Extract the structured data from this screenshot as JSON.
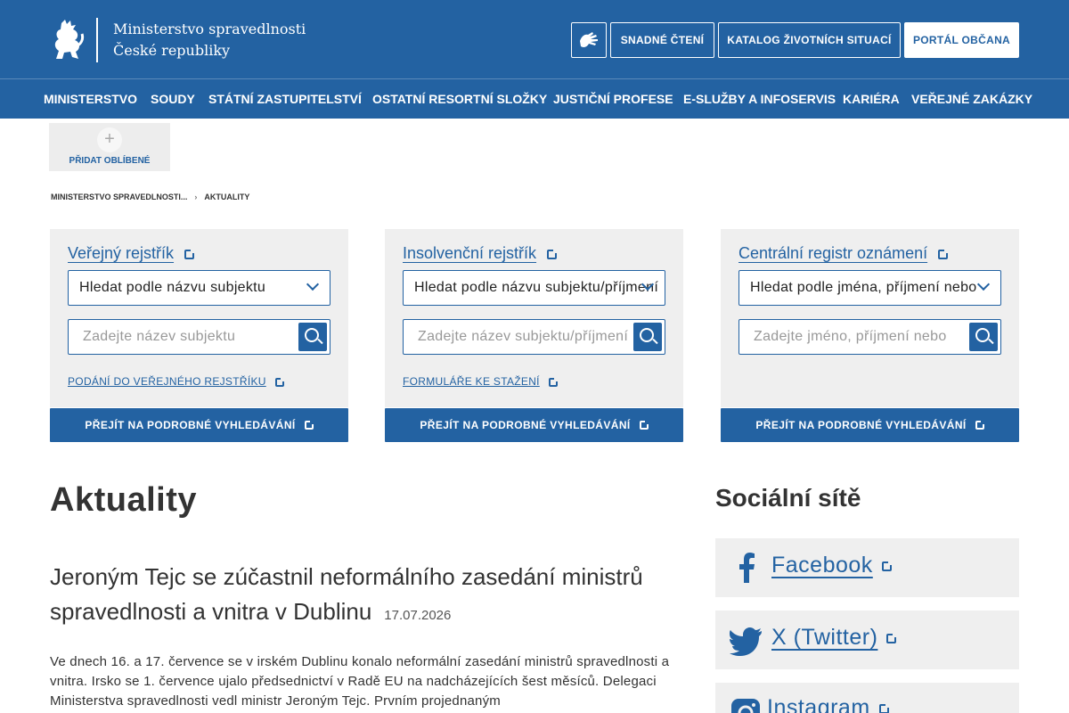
{
  "header": {
    "logo_line1": "Ministerstvo spravedlnosti",
    "logo_line2": "České republiky",
    "buttons": {
      "easy_read": "SNADNÉ ČTENÍ",
      "catalog": "KATALOG ŽIVOTNÍCH SITUACÍ",
      "portal": "PORTÁL OBČANA"
    }
  },
  "nav": {
    "items": [
      "MINISTERSTVO",
      "SOUDY",
      "STÁTNÍ ZASTUPITELSTVÍ",
      "OSTATNÍ RESORTNÍ SLOŽKY",
      "JUSTIČNÍ PROFESE",
      "E-SLUŽBY A INFOSERVIS",
      "KARIÉRA",
      "VEŘEJNÉ ZAKÁZKY"
    ]
  },
  "favorites": {
    "label": "PŘIDAT OBLÍBENÉ"
  },
  "breadcrumb": {
    "home": "MINISTERSTVO SPRAVEDLNOSTI...",
    "current": "AKTUALITY"
  },
  "cards": [
    {
      "title": "Veřejný rejstřík",
      "select_value": "Hledat podle názvu subjektu",
      "input_placeholder": "Zadejte název subjektu",
      "link": "PODÁNÍ DO VEŘEJNÉHO REJSTŘÍKU",
      "cta": "PŘEJÍT NA PODROBNÉ VYHLEDÁVÁNÍ"
    },
    {
      "title": "Insolvenční rejstřík",
      "select_value": "Hledat podle názvu subjektu/příjmení",
      "input_placeholder": "Zadejte název subjektu/příjmení",
      "link": "FORMULÁŘE KE STAŽENÍ",
      "cta": "PŘEJÍT NA PODROBNÉ VYHLEDÁVÁNÍ"
    },
    {
      "title": "Centrální registr oznámení",
      "select_value": "Hledat podle jména, příjmení nebo",
      "input_placeholder": "Zadejte jméno, příjmení nebo",
      "link": "",
      "cta": "PŘEJÍT NA PODROBNÉ VYHLEDÁVÁNÍ"
    }
  ],
  "news": {
    "section_title": "Aktuality",
    "article": {
      "title": "Jeroným Tejc se zúčastnil neformálního zasedání ministrů spravedlnosti a vnitra v Dublinu",
      "date": "17.07.2026",
      "body": "Ve dnech 16. a 17. července se v irském Dublinu konalo neformální zasedání ministrů spravedlnosti a vnitra. Irsko se 1. července ujalo předsednictví v Radě EU na nadcházejících šest měsíců. Delegaci Ministerstva spravedlnosti vedl ministr Jeroným Tejc. Prvním projednaným"
    }
  },
  "social": {
    "title": "Sociální sítě",
    "items": [
      {
        "label": "Facebook",
        "icon": "facebook-icon"
      },
      {
        "label": "X (Twitter)",
        "icon": "twitter-icon"
      },
      {
        "label": "Instagram",
        "icon": "instagram-icon"
      }
    ]
  },
  "colors": {
    "brand_blue": "#2362a2",
    "panel_gray": "#efefef"
  }
}
